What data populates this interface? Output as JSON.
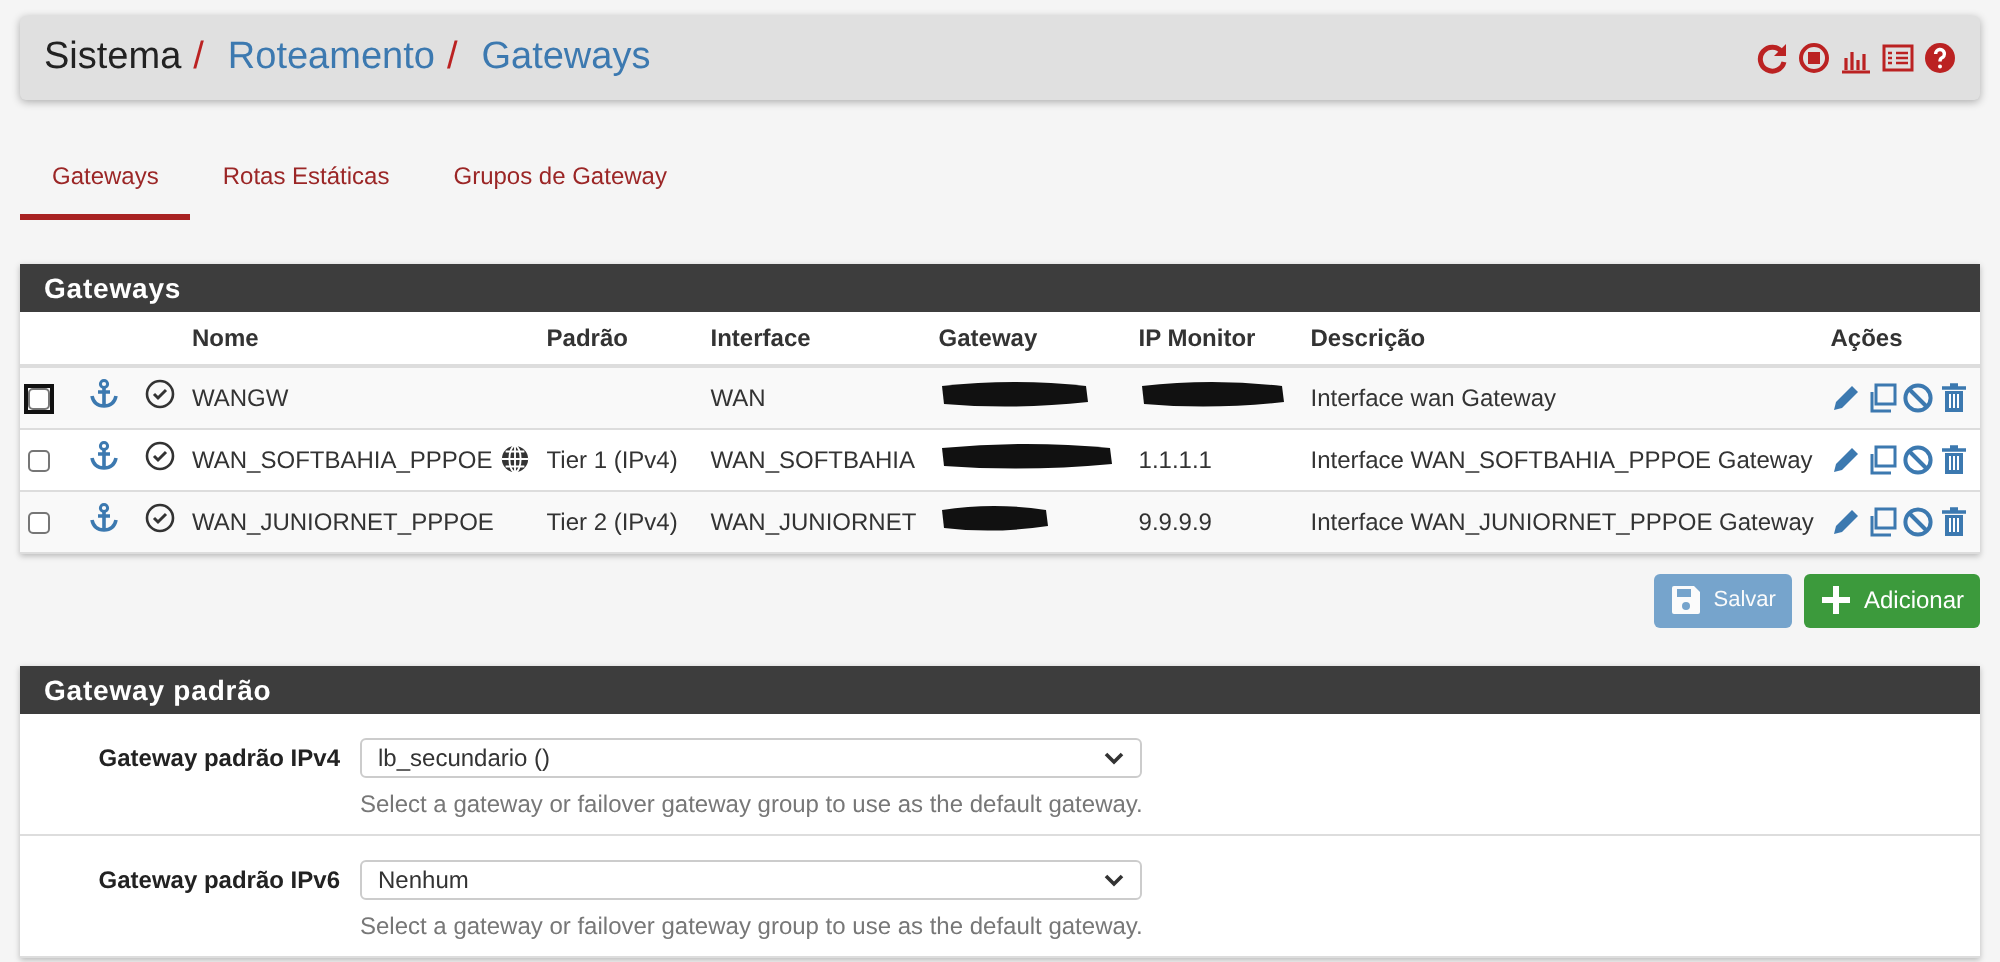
{
  "breadcrumb": [
    {
      "text": "Sistema",
      "link": false,
      "separator": "/"
    },
    {
      "text": "Roteamento",
      "link": true,
      "separator": "/"
    },
    {
      "text": "Gateways",
      "link": true
    }
  ],
  "tabs": [
    {
      "label": "Gateways",
      "selected": true
    },
    {
      "label": "Rotas Estáticas",
      "selected": false
    },
    {
      "label": "Grupos de Gateway",
      "selected": false
    }
  ],
  "gateways_panel": {
    "title": "Gateways",
    "columns": [
      "Nome",
      "Padrão",
      "Interface",
      "Gateway",
      "IP Monitor",
      "Descrição",
      "Ações"
    ],
    "rows": [
      {
        "checked": false,
        "focused": true,
        "name": "WANGW",
        "is_default": false,
        "interface": "WAN",
        "gateway_redacted": true,
        "ip_monitor_redacted": true,
        "description": "Interface wan Gateway"
      },
      {
        "checked": false,
        "focused": false,
        "name": "WAN_SOFTBAHIA_PPPOE",
        "is_default": true,
        "default_tier": "Tier 1 (IPv4)",
        "interface": "WAN_SOFTBAHIA",
        "gateway_redacted": true,
        "ip_monitor": "1.1.1.1",
        "ip_monitor_redacted": false,
        "description": "Interface WAN_SOFTBAHIA_PPPOE Gateway"
      },
      {
        "checked": false,
        "focused": false,
        "name": "WAN_JUNIORNET_PPPOE",
        "is_default": false,
        "default_tier": "Tier 2 (IPv4)",
        "interface": "WAN_JUNIORNET",
        "gateway_redacted": true,
        "ip_monitor": "9.9.9.9",
        "ip_monitor_redacted": false,
        "description": "Interface WAN_JUNIORNET_PPPOE Gateway"
      }
    ]
  },
  "buttons": [
    {
      "label": "Salvar",
      "kind": "save",
      "disabled": true
    },
    {
      "label": "Adicionar",
      "kind": "add",
      "disabled": false
    }
  ],
  "default_gateway_panel": {
    "title": "Gateway padrão",
    "fields": [
      {
        "label": "Gateway padrão IPv4",
        "value": "lb_secundario ()",
        "help": "Select a gateway or failover gateway group to use as the default gateway."
      },
      {
        "label": "Gateway padrão IPv6",
        "value": "Nenhum",
        "help": "Select a gateway or failover gateway group to use as the default gateway."
      }
    ]
  }
}
